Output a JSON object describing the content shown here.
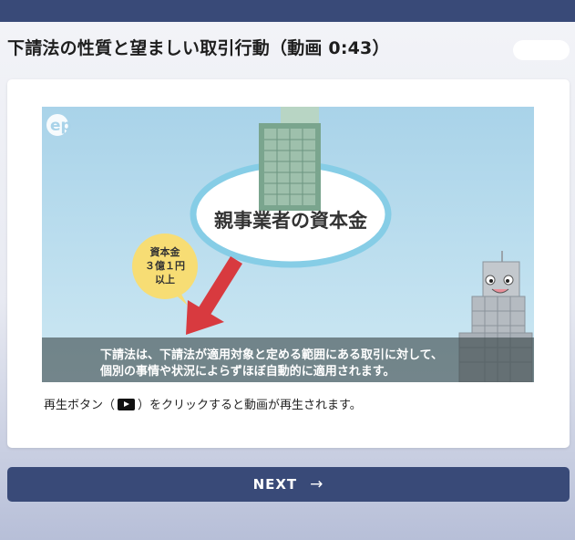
{
  "page": {
    "title": "下請法の性質と望ましい取引行動（動画 0:43）"
  },
  "video": {
    "logo_text": "ep",
    "heading_bubble": "親事業者の資本金",
    "callout": [
      "資本金",
      "３億１円",
      "以上"
    ],
    "subtitle": [
      "下請法は、下請法が適用対象と定める範囲にある取引に対して、",
      "個別の事情や状況によらずほぼ自動的に適用されます。"
    ]
  },
  "caption": {
    "before": "再生ボタン（",
    "after": "）をクリックすると動画が再生されます。",
    "icon": "play-icon"
  },
  "next_button": {
    "label": "NEXT",
    "icon": "arrow-right-icon"
  },
  "colors": {
    "header": "#394a78",
    "button": "#394a78",
    "callout": "#f7dd74",
    "arrow": "#d83a3f"
  }
}
